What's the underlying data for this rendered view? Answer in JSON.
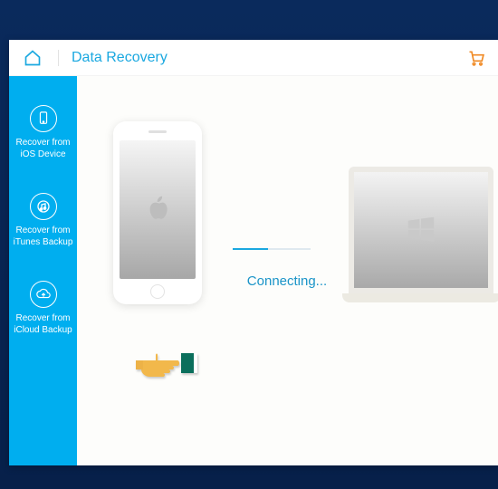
{
  "header": {
    "title": "Data Recovery"
  },
  "sidebar": {
    "items": [
      {
        "label": "Recover from\niOS Device"
      },
      {
        "label": "Recover from\niTunes Backup"
      },
      {
        "label": "Recover from\niCloud Backup"
      }
    ]
  },
  "main": {
    "status": "Connecting..."
  },
  "colors": {
    "accent": "#00aeef",
    "link": "#1aa8e0",
    "cart": "#f08a24"
  }
}
